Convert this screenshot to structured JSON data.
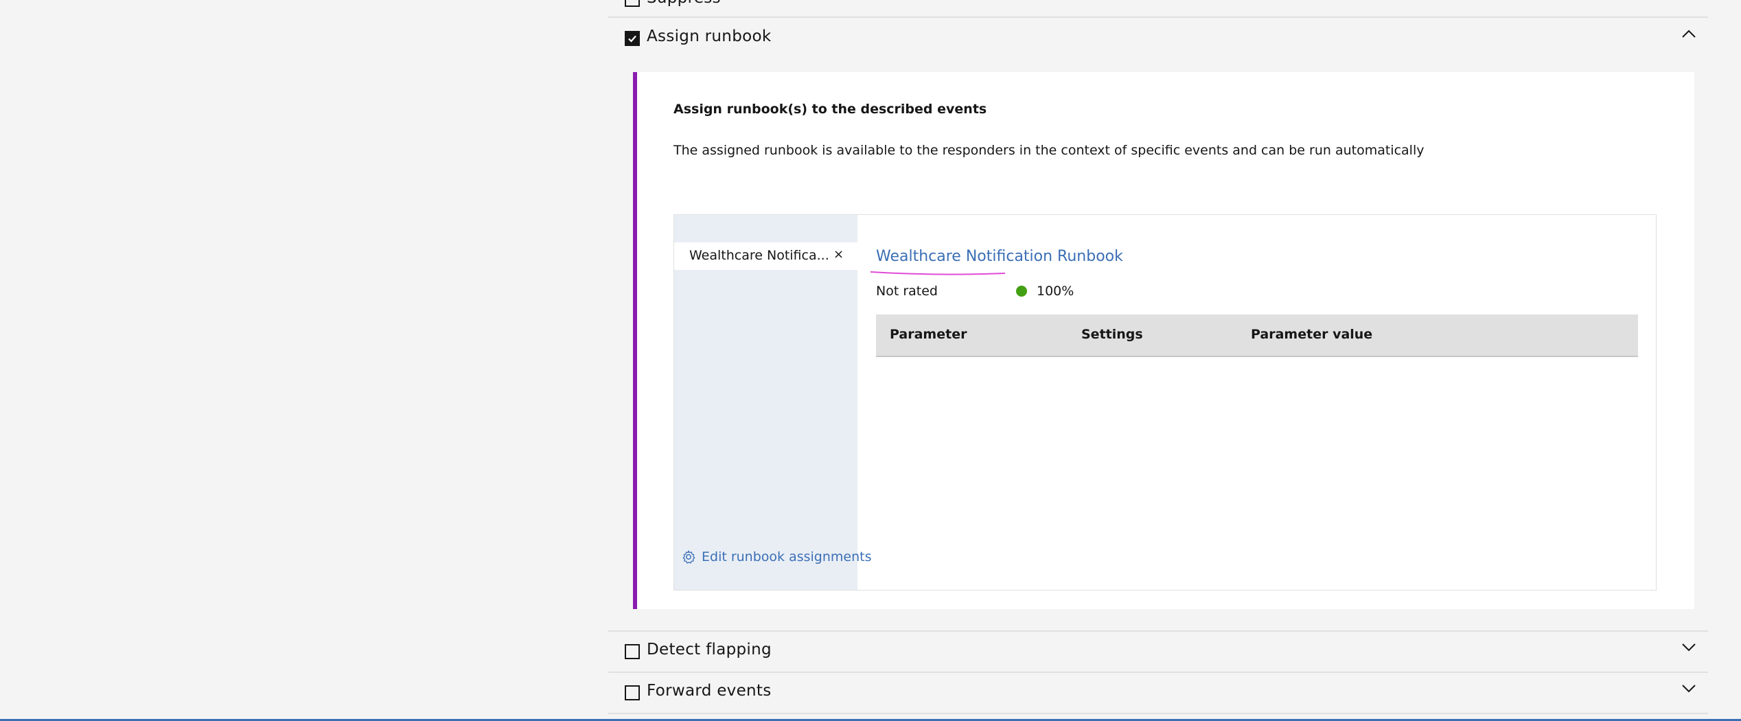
{
  "rows": {
    "suppress": {
      "label": "Suppress",
      "checked": false
    },
    "assign_runbook": {
      "label": "Assign runbook",
      "checked": true,
      "expanded": true
    },
    "detect_flapping": {
      "label": "Detect flapping",
      "checked": false,
      "expanded": false
    },
    "forward_events": {
      "label": "Forward events",
      "checked": false,
      "expanded": false
    }
  },
  "card": {
    "heading": "Assign runbook(s) to the described events",
    "description": "The assigned runbook is available to the responders in the context of specific events and can be run automatically"
  },
  "runbooks": {
    "tabs": [
      {
        "label": "Wealthcare Notifica...",
        "close": "×"
      }
    ],
    "edit_link": "Edit runbook assignments",
    "selected": {
      "title": "Wealthcare Notification Runbook",
      "rating": "Not rated",
      "score": "100%",
      "score_color": "#42a012"
    },
    "table_headers": [
      "Parameter",
      "Settings",
      "Parameter value"
    ]
  },
  "colors": {
    "accent_border": "#8a1cae",
    "link": "#3b6fb5"
  },
  "icons": [
    "checkmark-icon",
    "chevron-up-icon",
    "chevron-down-icon",
    "settings-icon",
    "close-icon"
  ]
}
